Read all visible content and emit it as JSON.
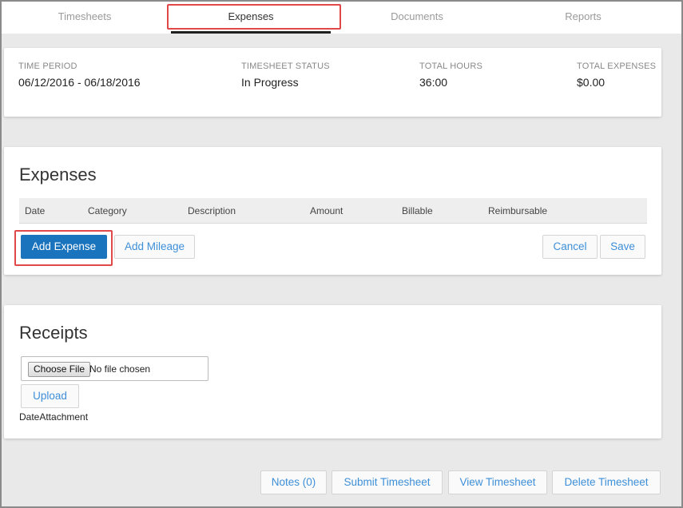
{
  "tabs": [
    {
      "label": "Timesheets",
      "active": false
    },
    {
      "label": "Expenses",
      "active": true
    },
    {
      "label": "Documents",
      "active": false
    },
    {
      "label": "Reports",
      "active": false
    }
  ],
  "summary": {
    "time_period": {
      "label": "TIME PERIOD",
      "value": "06/12/2016 - 06/18/2016"
    },
    "status": {
      "label": "TIMESHEET STATUS",
      "value": "In Progress"
    },
    "hours": {
      "label": "TOTAL HOURS",
      "value": "36:00"
    },
    "expenses": {
      "label": "TOTAL EXPENSES",
      "value": "$0.00"
    }
  },
  "expenses_section": {
    "title": "Expenses",
    "columns": [
      "Date",
      "Category",
      "Description",
      "Amount",
      "Billable",
      "Reimbursable"
    ],
    "add_expense_label": "Add Expense",
    "add_mileage_label": "Add Mileage",
    "cancel_label": "Cancel",
    "save_label": "Save"
  },
  "receipts_section": {
    "title": "Receipts",
    "choose_file_label": "Choose File",
    "file_status": "No file chosen",
    "upload_label": "Upload",
    "date_attachment_label": "DateAttachment"
  },
  "footer": {
    "notes_label": "Notes (0)",
    "submit_label": "Submit Timesheet",
    "view_label": "View Timesheet",
    "delete_label": "Delete Timesheet"
  },
  "colors": {
    "primary": "#1a73bd",
    "link": "#3d8fd8",
    "highlight": "#e0484a"
  }
}
